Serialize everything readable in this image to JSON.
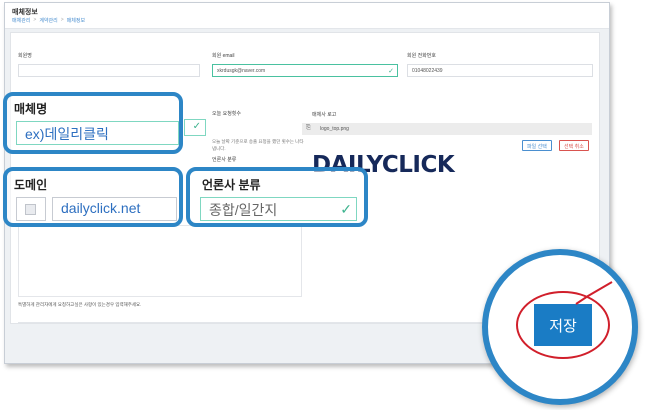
{
  "header": {
    "title": "매체정보",
    "breadcrumb": [
      "매체관리",
      "계약관리",
      "매체정보"
    ],
    "breadcrumb_sep": ">"
  },
  "form": {
    "member_name_label": "회원명",
    "member_email_label": "회원 email",
    "member_email_value": "xkrdusgk@naver.com",
    "member_phone_label": "회원 전화번호",
    "member_phone_value": "01048022439",
    "daily_request_label": "오늘 요청횟수",
    "daily_request_desc": "오늘 날짜 기준으로 송출 요청을 했던 횟수는 나타냅니다.",
    "press_category_small_label": "언론사 분류",
    "logo_label": "매체사 로고",
    "logo_filename": "logo_top.png",
    "select_file_label": "파일 선택",
    "cancel_select_label": "선택 취소",
    "brand_logo_text": "DAILYCLICK",
    "notice_text": "특별하게 관리자에게 요청하고싶은 사항이 있는경우 입력해주세요."
  },
  "callouts": {
    "media_name_label": "매체명",
    "media_name_value": "ex)데일리클릭",
    "domain_label": "도메인",
    "domain_value": "dailyclick.net",
    "press_category_label": "언론사 분류",
    "press_category_value": "종합/일간지"
  },
  "actions": {
    "save_label": "저장"
  },
  "colors": {
    "accent": "#2d86c6",
    "primary_button": "#1a7cc5",
    "valid": "#3db38e",
    "danger": "#d11f2b",
    "brand": "#16295a"
  }
}
